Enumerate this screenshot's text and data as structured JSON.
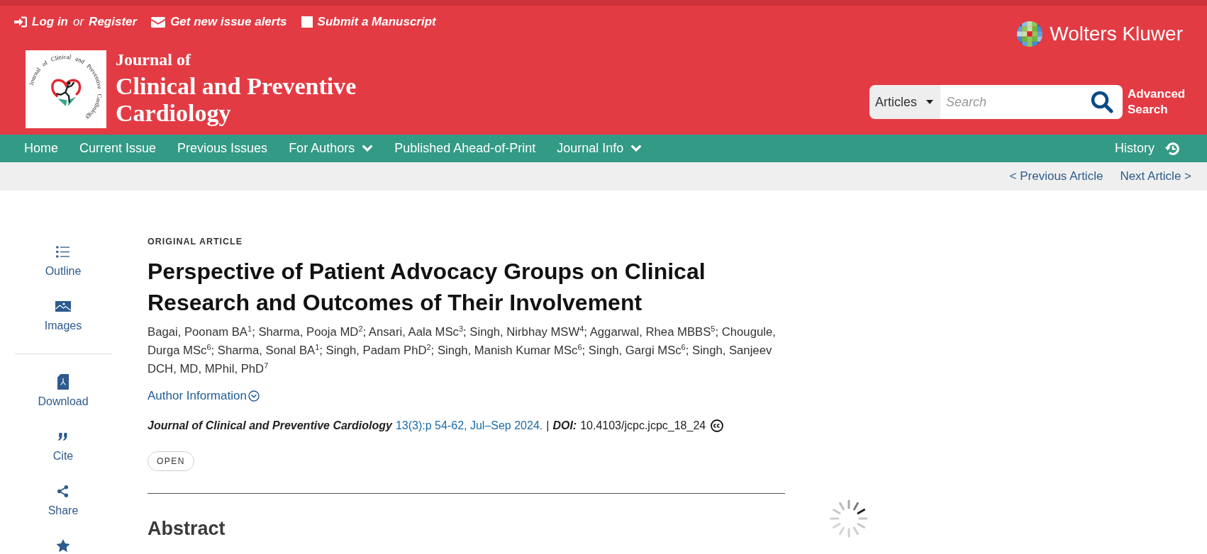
{
  "utility_bar": {
    "log_in": "Log in",
    "or": "or",
    "register": "Register",
    "links": [
      "Get new issue alerts",
      "Submit a Manuscript"
    ]
  },
  "journal": {
    "logo_ring_text": "Journal of Clinical and Preventive Cardiology",
    "title_lines": [
      "Journal of",
      "Clinical and Preventive",
      "Cardiology"
    ]
  },
  "publisher": {
    "name": "Wolters Kluwer"
  },
  "search": {
    "scope": "Articles",
    "placeholder": "Search",
    "advanced_link": "Advanced Search"
  },
  "nav": {
    "items": [
      {
        "label": "Home",
        "dropdown": false
      },
      {
        "label": "Current Issue",
        "dropdown": false
      },
      {
        "label": "Previous Issues",
        "dropdown": false
      },
      {
        "label": "For Authors",
        "dropdown": true
      },
      {
        "label": "Published Ahead-of-Print",
        "dropdown": false
      },
      {
        "label": "Journal Info",
        "dropdown": true
      }
    ],
    "history": "History"
  },
  "article_nav": {
    "previous": "< Previous Article",
    "next": "Next Article >"
  },
  "sidebar": {
    "sections": [
      {
        "items": [
          {
            "kind": "labeled",
            "label": "Outline"
          },
          {
            "kind": "labeled",
            "label": "Images"
          }
        ]
      },
      {
        "items": [
          {
            "kind": "labeled",
            "label": "Download"
          },
          {
            "kind": "labeled",
            "label": "Cite"
          },
          {
            "kind": "labeled",
            "label": "Share"
          },
          {
            "kind": "icon_only"
          }
        ]
      }
    ]
  },
  "article": {
    "type": "ORIGINAL ARTICLE",
    "title": "Perspective of Patient Advocacy Groups on Clinical Research and Outcomes of Their Involvement",
    "authors": "Bagai, Poonam BA$^{1}$; Sharma, Pooja MD$^{2}$; Ansari, Aala MSc$^{3}$; Singh, Nirbhay MSW$^{4}$; Aggarwal, Rhea MBBS$^{5}$; Chougule, Durga MSc$^{6}$; Sharma, Sonal BA$^{1}$; Singh, Padam PhD$^{2}$; Singh, Manish Kumar MSc$^{6}$; Singh, Gargi MSc$^{6}$; Singh, Sanjeev DCH, MD, MPhil, PhD$^{7}$",
    "author_info_link": "Author Information",
    "citation": {
      "journal": "Journal of Clinical and Preventive Cardiology",
      "issue": "13(3):p 54-62, Jul–Sep 2024.",
      "separator": "|",
      "doi_label": "DOI:",
      "doi": "10.4103/jcpc.jcpc_18_24"
    },
    "access_badge": "OPEN",
    "section_heading": "Abstract"
  }
}
